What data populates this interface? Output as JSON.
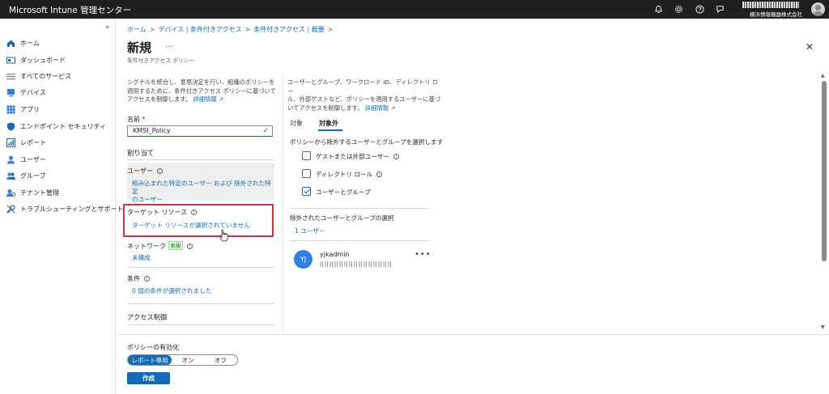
{
  "app": {
    "title": "Microsoft Intune 管理センター",
    "org": "横浜情報機器株式会社"
  },
  "sidebar": {
    "items": [
      {
        "label": "ホーム",
        "icon": "home-icon"
      },
      {
        "label": "ダッシュボード",
        "icon": "dashboard-icon"
      },
      {
        "label": "すべてのサービス",
        "icon": "all-services-icon"
      },
      {
        "label": "デバイス",
        "icon": "devices-icon"
      },
      {
        "label": "アプリ",
        "icon": "apps-icon"
      },
      {
        "label": "エンドポイント セキュリティ",
        "icon": "endpoint-security-icon"
      },
      {
        "label": "レポート",
        "icon": "reports-icon"
      },
      {
        "label": "ユーザー",
        "icon": "users-icon"
      },
      {
        "label": "グループ",
        "icon": "groups-icon"
      },
      {
        "label": "テナント管理",
        "icon": "tenant-admin-icon"
      },
      {
        "label": "トラブルシューティングとサポート",
        "icon": "troubleshooting-icon"
      }
    ]
  },
  "breadcrumb": [
    "ホーム",
    "デバイス | 条件付きアクセス",
    "条件付きアクセス | 概要"
  ],
  "header": {
    "title": "新規",
    "more": "…",
    "subtitle": "条件付きアクセス ポリシー"
  },
  "left": {
    "desc_lines": [
      "シグナルを統合し、意思決定を行い、組織のポリシーを",
      "適用するために、条件付きアクセス ポリシーに基づいて",
      "アクセスを制御します。"
    ],
    "learn_more": "詳細情報",
    "name_label": "名前",
    "required_mark": "*",
    "name_value": "KMSI_Policy",
    "assignments": "割り当て",
    "users_label": "ユーザー",
    "users_value_lines": [
      "組み込まれた特定のユーザー および 除外された特定",
      "のユーザー"
    ],
    "target_label": "ターゲット リソース",
    "target_value": "ターゲット リソースが選択されていません",
    "network_label": "ネットワーク",
    "new_badge": "新規",
    "network_value": "未構成",
    "conditions_label": "条件",
    "conditions_value": "0 個の条件が選択されました",
    "access_controls": "アクセス制御"
  },
  "right": {
    "desc_lines": [
      "ユーザーとグループ、ワークロード ID、ディレクトリ ロー",
      "ル、外部ゲストなど、ポリシーを適用するユーザーに基づ",
      "いてアクセスを制御します。"
    ],
    "learn_more": "詳細情報",
    "tabs": [
      "対象",
      "対象外"
    ],
    "exclude_heading": "ポリシーから除外するユーザーとグループを選択します",
    "options": [
      {
        "label": "ゲストまたは外部ユーザー",
        "checked": false
      },
      {
        "label": "ディレクトリ ロール",
        "checked": false
      },
      {
        "label": "ユーザーとグループ",
        "checked": true
      }
    ],
    "selected_heading": "除外されたユーザーとグループの選択",
    "selected_count": "1 ユーザー",
    "user": {
      "initials": "YJ",
      "name": "yjkadmin",
      "more": "•••"
    }
  },
  "footer": {
    "enable_label": "ポリシーの有効化",
    "toggle_options": [
      "レポート専用",
      "オン",
      "オフ"
    ],
    "selected_option": "レポート専用",
    "create_label": "作成"
  },
  "colors": {
    "accent": "#0f6cbd",
    "highlight": "#d13438",
    "topbar": "#1f1f1f"
  }
}
